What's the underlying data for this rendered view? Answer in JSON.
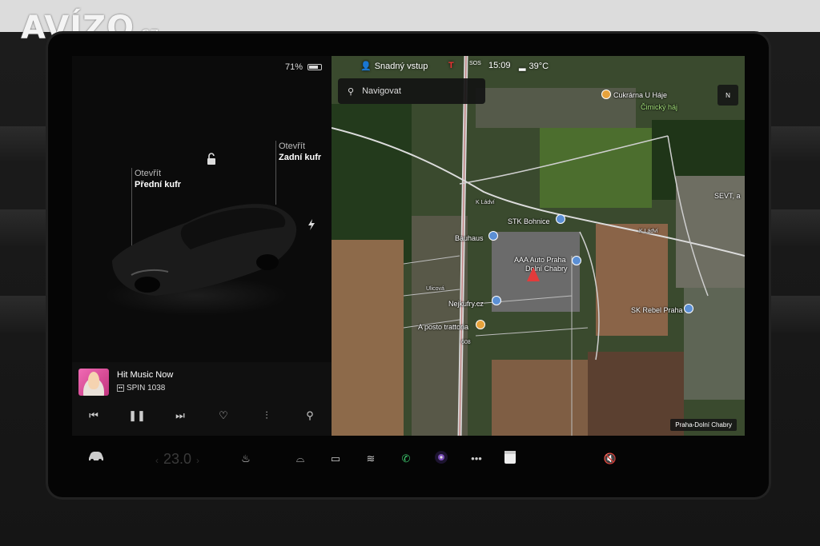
{
  "watermark": {
    "brand": "AVÍZO",
    "suffix": ".cz"
  },
  "status": {
    "battery": "71%",
    "battery_level": 0.71
  },
  "car": {
    "frunk_action": "Otevřít",
    "frunk_label": "Přední kufr",
    "trunk_action": "Otevřít",
    "trunk_label": "Zadní kufr"
  },
  "music": {
    "title": "Hit Music Now",
    "station": "SPIN 1038",
    "controls": [
      "prev-icon",
      "pause-icon",
      "next-icon",
      "heart-icon",
      "equalizer-icon",
      "search-icon"
    ]
  },
  "map": {
    "topbar": {
      "profile": "Snadný vstup",
      "sos": "SOS",
      "time": "15:09",
      "temperature": "39°C"
    },
    "search_placeholder": "Navigovat",
    "compass": "N",
    "location": "Praha-Dolní Chabry",
    "labels": {
      "poi_cukrarna": "Cukrárna U Háje",
      "poi_cimicky": "Čimický háj",
      "poi_stk": "STK Bohnice",
      "street_kladvi_1": "K Ládví",
      "street_kladvi_2": "K Ládví",
      "poi_bauhaus": "Bauhaus",
      "poi_aaa": "AAA Auto Praha",
      "poi_aaa_2": "Dolní Chabry",
      "poi_nejkufry": "Nejkufry.cz",
      "poi_trattoria": "A posto trattoria",
      "poi_rebel": "SK Rebel Praha",
      "poi_sever": "SEVT, a",
      "street_ulicova": "Ulicová",
      "street_608": "608"
    }
  },
  "dock": {
    "temperature": "23.0",
    "icons": [
      "car-icon",
      "seat-heat-icon",
      "defrost-front-icon",
      "defrost-rear-icon",
      "heater-icon",
      "phone-icon",
      "camera-icon",
      "more-icon",
      "calendar-icon",
      "volume-mute-icon"
    ]
  },
  "colors": {
    "map_pin": "#5b8fd4",
    "poi_orange": "#e6a23c",
    "phone_green": "#3cc46b",
    "car_arrow": "#e23b3b"
  }
}
